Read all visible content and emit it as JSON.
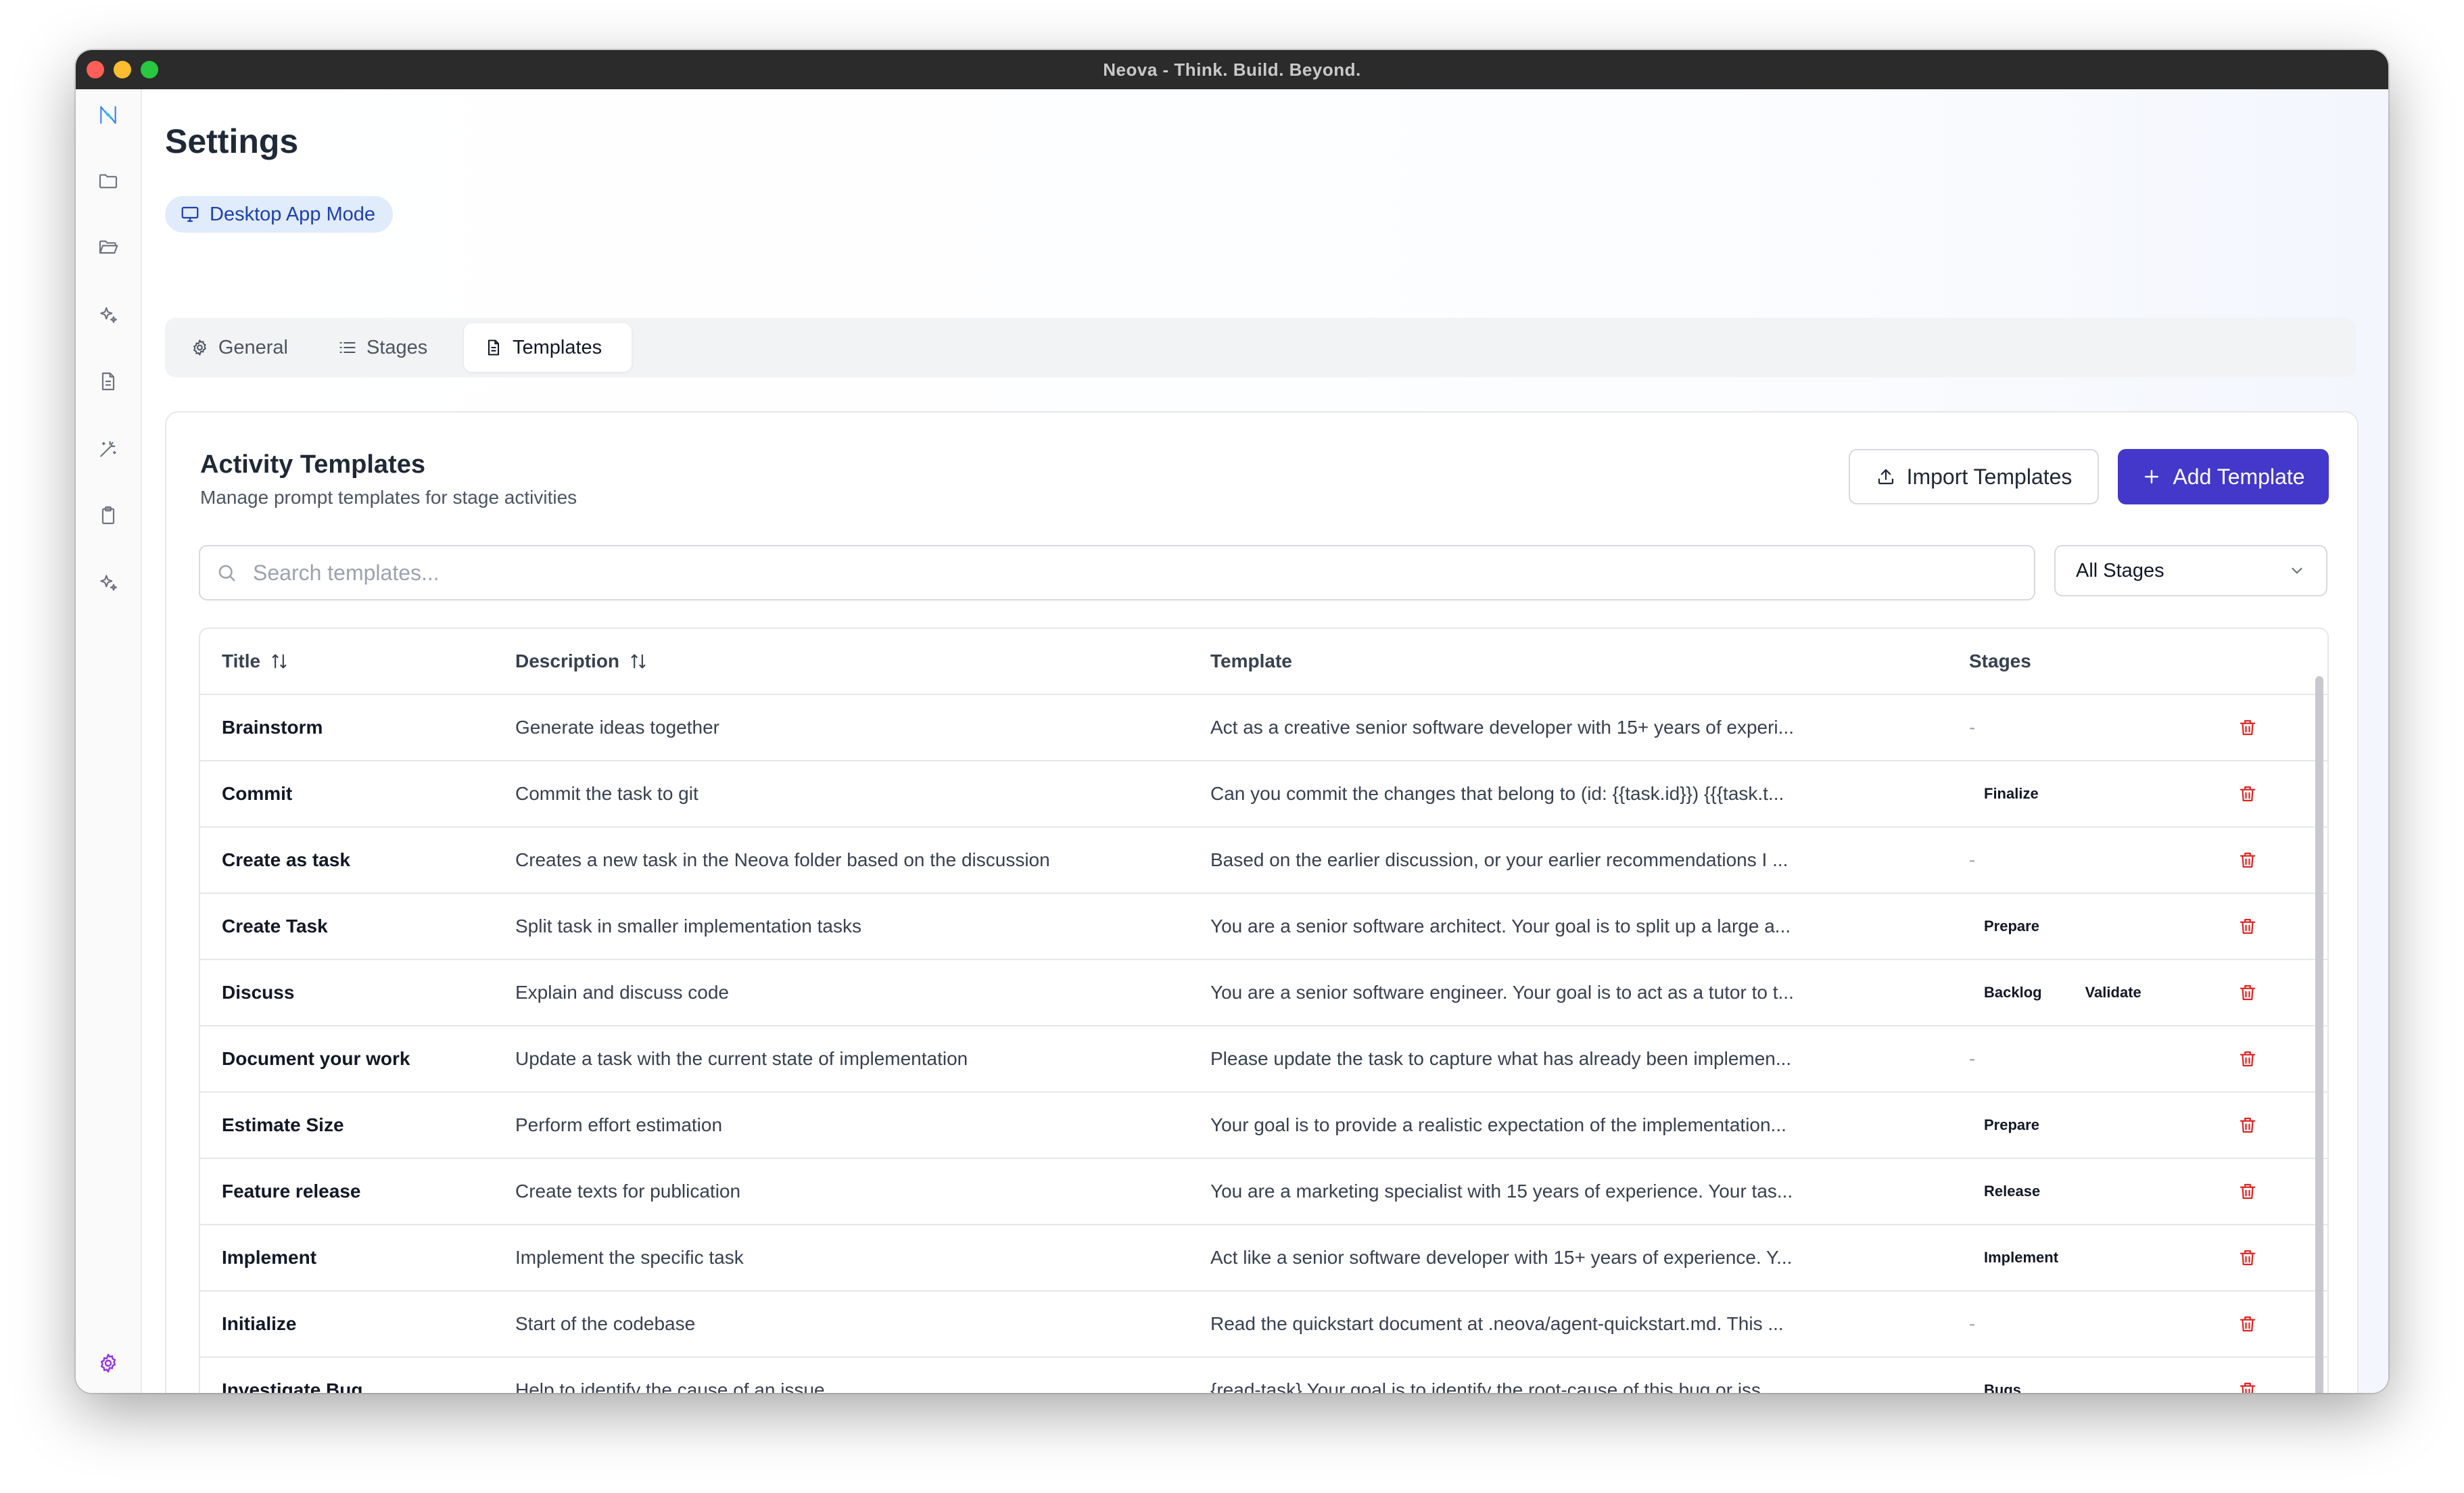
{
  "window": {
    "title": "Neova - Think. Build. Beyond.",
    "traffic_colors": [
      "#ff5f57",
      "#febc2e",
      "#28c840"
    ]
  },
  "sidebar": {
    "items": [
      {
        "icon": "neova-logo-icon"
      },
      {
        "icon": "folder-icon"
      },
      {
        "icon": "folder-open-icon"
      },
      {
        "icon": "sparkles-icon"
      },
      {
        "icon": "document-icon"
      },
      {
        "icon": "magic-wand-icon"
      },
      {
        "icon": "clipboard-icon"
      },
      {
        "icon": "sparkles-icon"
      },
      {
        "icon": "settings-gear-icon"
      }
    ]
  },
  "page": {
    "title": "Settings",
    "mode_label": "Desktop App Mode"
  },
  "tabs": [
    {
      "label": "General",
      "icon": "gear-icon",
      "active": false
    },
    {
      "label": "Stages",
      "icon": "list-icon",
      "active": false
    },
    {
      "label": "Templates",
      "icon": "file-icon",
      "active": true
    }
  ],
  "card": {
    "title": "Activity Templates",
    "subtitle": "Manage prompt templates for stage activities",
    "import_label": "Import Templates",
    "add_label": "Add Template",
    "search_placeholder": "Search templates...",
    "stage_filter": "All Stages"
  },
  "table": {
    "headers": {
      "title": "Title",
      "description": "Description",
      "template": "Template",
      "stages": "Stages"
    },
    "rows": [
      {
        "title": "Brainstorm",
        "description": "Generate ideas together",
        "template": "Act as a creative senior software developer with 15+ years of experi...",
        "stages": []
      },
      {
        "title": "Commit",
        "description": "Commit the task to git",
        "template": "Can you commit the changes that belong to (id: {{task.id}}) {{{task.t...",
        "stages": [
          "Finalize"
        ]
      },
      {
        "title": "Create as task",
        "description": "Creates a new task in the Neova folder based on the discussion",
        "template": "Based on the earlier discussion, or your earlier recommendations I ...",
        "stages": []
      },
      {
        "title": "Create Task",
        "description": "Split task in smaller implementation tasks",
        "template": "You are a senior software architect. Your goal is to split up a large a...",
        "stages": [
          "Prepare"
        ]
      },
      {
        "title": "Discuss",
        "description": "Explain and discuss code",
        "template": "You are a senior software engineer. Your goal is to act as a tutor to t...",
        "stages": [
          "Backlog",
          "Validate"
        ]
      },
      {
        "title": "Document your work",
        "description": "Update a task with the current state of implementation",
        "template": "Please update the task to capture what has already been implemen...",
        "stages": []
      },
      {
        "title": "Estimate Size",
        "description": "Perform effort estimation",
        "template": "Your goal is to provide a realistic expectation of the implementation...",
        "stages": [
          "Prepare"
        ]
      },
      {
        "title": "Feature release",
        "description": "Create texts for publication",
        "template": "You are a marketing specialist with 15 years of experience. Your tas...",
        "stages": [
          "Release"
        ]
      },
      {
        "title": "Implement",
        "description": "Implement the specific task",
        "template": "Act like a senior software developer with 15+ years of experience. Y...",
        "stages": [
          "Implement"
        ]
      },
      {
        "title": "Initialize",
        "description": "Start of the codebase",
        "template": "Read the quickstart document at .neova/agent-quickstart.md. This ...",
        "stages": []
      },
      {
        "title": "Investigate Bug",
        "description": "Help to identify the cause of an issue",
        "template": "{read-task} Your goal is to identify the root-cause of this bug or iss...",
        "stages": [
          "Bugs"
        ]
      }
    ]
  },
  "colors": {
    "accent": "#4338ca",
    "delete": "#dc2626",
    "mode_pill_bg": "#e0ebfb",
    "settings_icon": "#9333ea"
  }
}
